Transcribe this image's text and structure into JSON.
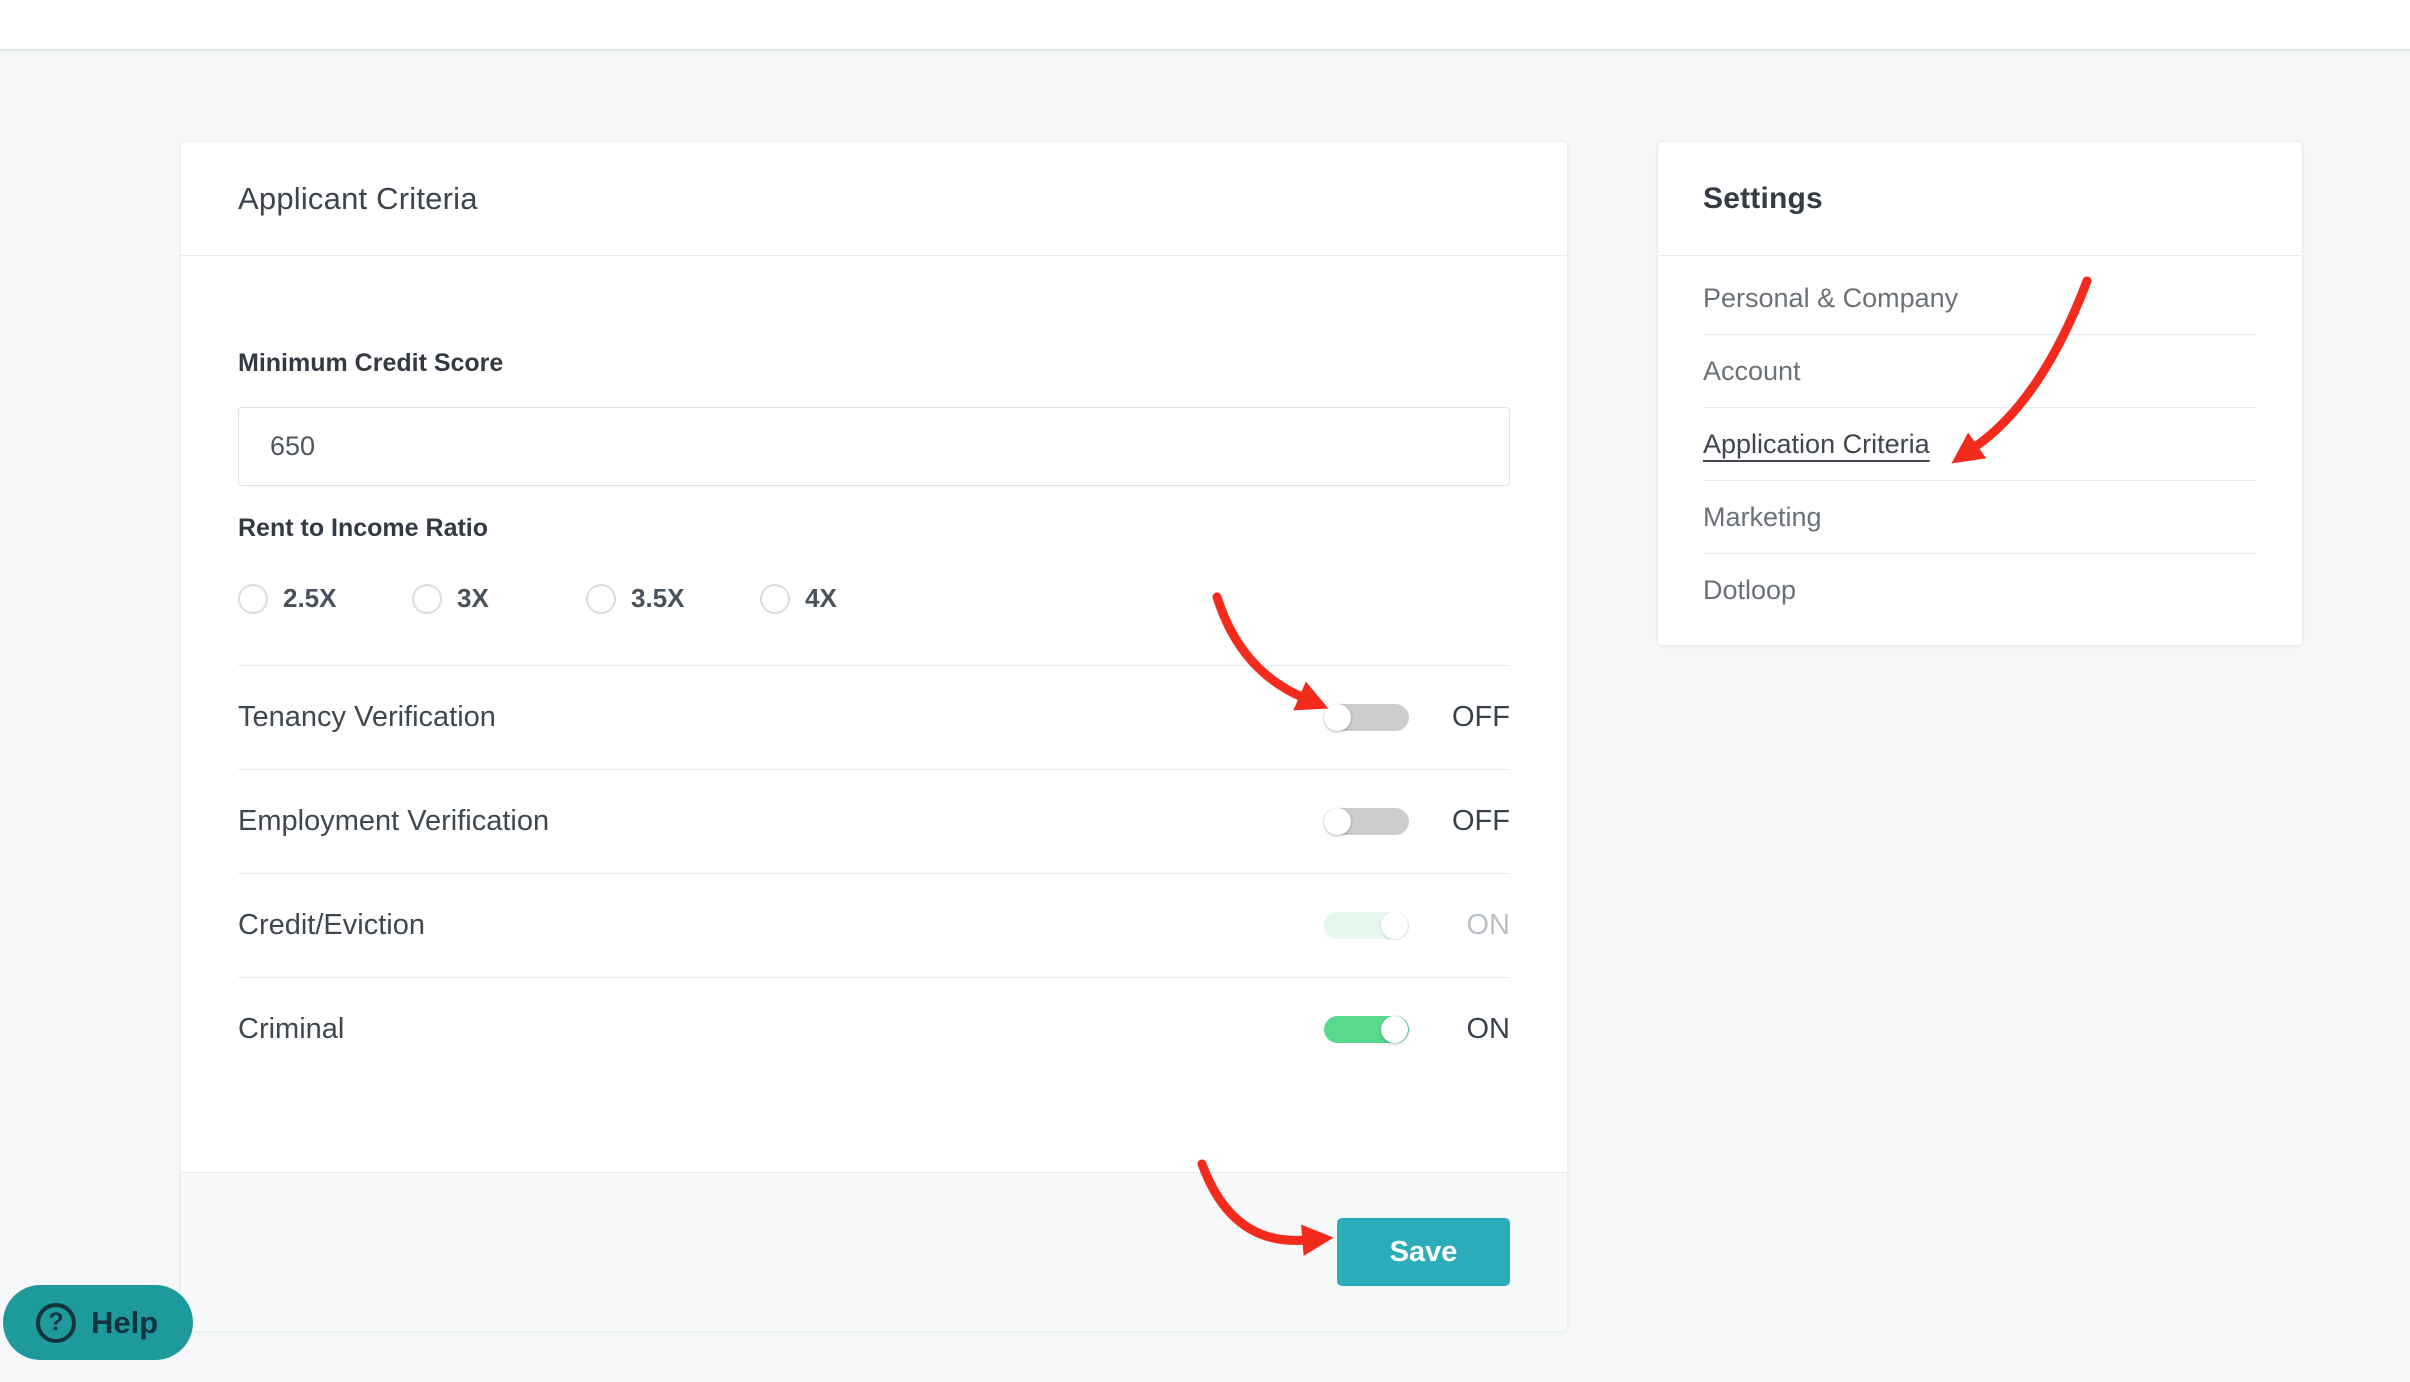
{
  "applicant": {
    "title": "Applicant Criteria",
    "credit_score": {
      "label": "Minimum Credit Score",
      "value": "650"
    },
    "rent_ratio": {
      "label": "Rent to Income Ratio",
      "options": [
        {
          "label": "2.5X",
          "selected": false
        },
        {
          "label": "3X",
          "selected": false
        },
        {
          "label": "3.5X",
          "selected": false
        },
        {
          "label": "4X",
          "selected": false
        }
      ]
    },
    "toggles": [
      {
        "label": "Tenancy Verification",
        "state": "OFF",
        "on": false,
        "disabled": false
      },
      {
        "label": "Employment Verification",
        "state": "OFF",
        "on": false,
        "disabled": false
      },
      {
        "label": "Credit/Eviction",
        "state": "ON",
        "on": true,
        "disabled": true
      },
      {
        "label": "Criminal",
        "state": "ON",
        "on": true,
        "disabled": false
      }
    ],
    "save_label": "Save"
  },
  "settings": {
    "title": "Settings",
    "items": [
      {
        "label": "Personal & Company",
        "active": false
      },
      {
        "label": "Account",
        "active": false
      },
      {
        "label": "Application Criteria",
        "active": true
      },
      {
        "label": "Marketing",
        "active": false
      },
      {
        "label": "Dotloop",
        "active": false
      }
    ]
  },
  "help": {
    "label": "Help",
    "icon": "?"
  },
  "colors": {
    "accent_teal": "#2cacb9",
    "help_teal": "#1f9a9c",
    "toggle_on_green": "#57da8e",
    "toggle_on_disabled_green": "#e3f7ec",
    "toggle_off_gray": "#cdcdcd",
    "annotation_red": "#f22b1d",
    "page_background": "#f5f7f8"
  }
}
